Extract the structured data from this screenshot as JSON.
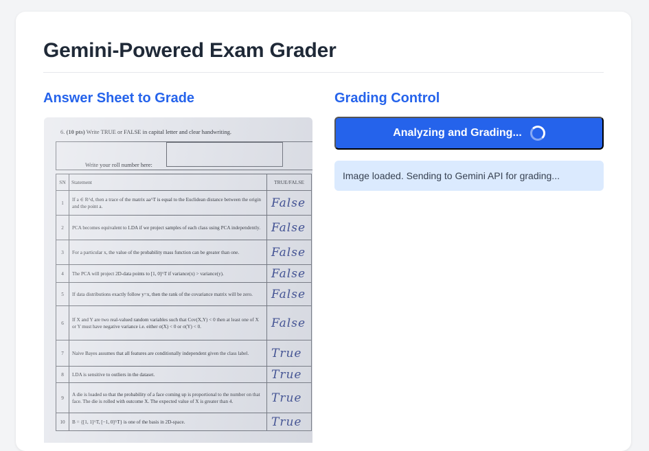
{
  "header": {
    "title": "Gemini-Powered Exam Grader"
  },
  "left": {
    "title": "Answer Sheet to Grade"
  },
  "right": {
    "title": "Grading Control",
    "button_label": "Analyzing and Grading...",
    "status_text": "Image loaded. Sending to Gemini API for grading..."
  },
  "sheet": {
    "question_number": "6.",
    "question_points": "(10 pts)",
    "question_text": "Write TRUE or FALSE in capital letter and clear handwriting.",
    "roll_label": "Write your roll number here:",
    "columns": [
      "SN",
      "Statement",
      "TRUE/FALSE"
    ],
    "rows": [
      {
        "sn": "1",
        "statement": "If a ∈ R^d, then a trace of the matrix aa^T is equal to the Euclidean distance between the origin and the point a.",
        "answer": "False"
      },
      {
        "sn": "2",
        "statement": "PCA becomes equivalent to LDA if we project samples of each class using PCA independently.",
        "answer": "False"
      },
      {
        "sn": "3",
        "statement": "For a particular x, the value of the probability mass function can be greater than one.",
        "answer": "False"
      },
      {
        "sn": "4",
        "statement": "The PCA will project 2D-data points to [1, 0]^T if variance(x) > variance(y).",
        "answer": "False"
      },
      {
        "sn": "5",
        "statement": "If data distributions exactly follow y=x, then the rank of the covariance matrix will be zero.",
        "answer": "False"
      },
      {
        "sn": "6",
        "statement": "If X and Y are two real-valued random variables such that Cov(X,Y) < 0 then at least one of X or Y must have negative variance i.e. either σ(X) < 0 or σ(Y) < 0.",
        "answer": "False"
      },
      {
        "sn": "7",
        "statement": "Naive Bayes assumes that all features are conditionally independent given the class label.",
        "answer": "True"
      },
      {
        "sn": "8",
        "statement": "LDA is sensitive to outliers in the dataset.",
        "answer": "True"
      },
      {
        "sn": "9",
        "statement": "A die is loaded so that the probability of a face coming up is proportional to the number on that face. The die is rolled with outcome X. The expected value of X is greater than 4.",
        "answer": "True"
      },
      {
        "sn": "10",
        "statement": "B = {[1, 1]^T, [−1, 0]^T} is one of the basis in 2D-space.",
        "answer": "True"
      }
    ]
  }
}
